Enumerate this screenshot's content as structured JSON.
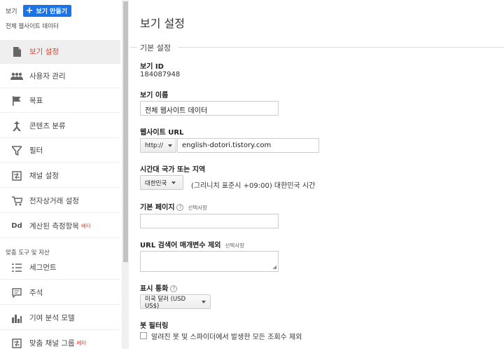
{
  "sidebar": {
    "top_label": "보기",
    "create_button": "보기 만들기",
    "view_name": "전체 웹사이트 데이터",
    "items": [
      {
        "label": "보기 설정",
        "icon": "document-icon",
        "active": true
      },
      {
        "label": "사용자 관리",
        "icon": "users-icon"
      },
      {
        "label": "목표",
        "icon": "flag-icon"
      },
      {
        "label": "콘텐츠 분류",
        "icon": "content-grouping-icon"
      },
      {
        "label": "필터",
        "icon": "filter-icon"
      },
      {
        "label": "채널 설정",
        "icon": "channel-settings-icon"
      },
      {
        "label": "전자상거래 설정",
        "icon": "cart-icon"
      },
      {
        "label": "계산된 측정항목",
        "icon": "dd-icon",
        "beta": "베타"
      }
    ],
    "section_label": "맞춤 도구 및 자산",
    "items2": [
      {
        "label": "세그먼트",
        "icon": "segments-icon"
      },
      {
        "label": "주석",
        "icon": "annotation-icon"
      },
      {
        "label": "기여 분석 모델",
        "icon": "bar-chart-icon"
      },
      {
        "label": "맞춤 채널 그룹",
        "icon": "custom-channel-icon",
        "beta": "베타"
      }
    ]
  },
  "main": {
    "title": "보기 설정",
    "section": "기본 설정",
    "view_id_label": "보기 ID",
    "view_id_value": "184087948",
    "view_name_label": "보기 이름",
    "view_name_value": "전체 웹사이트 데이터",
    "url_label": "웹사이트 URL",
    "url_protocol": "http://",
    "url_value": "english-dotori.tistory.com",
    "tz_label": "시간대 국가 또는 지역",
    "tz_country": "대한민국",
    "tz_text": "(그리니치 표준시 +09:00) 대한민국 시간",
    "default_page_label": "기본 페이지",
    "default_page_optional": "선택사항",
    "exclude_label": "URL 검색어 매개변수 제외",
    "exclude_optional": "선택사항",
    "currency_label": "표시 통화",
    "currency_value": "미국 달러 (USD US$)",
    "bot_label": "봇 필터링",
    "bot_checkbox_label": "알려진 봇 및 스파이더에서 발생한 모든 조회수 제외",
    "help_glyph": "?"
  },
  "colors": {
    "accent": "#1a73e8",
    "active_text": "#d14836"
  }
}
